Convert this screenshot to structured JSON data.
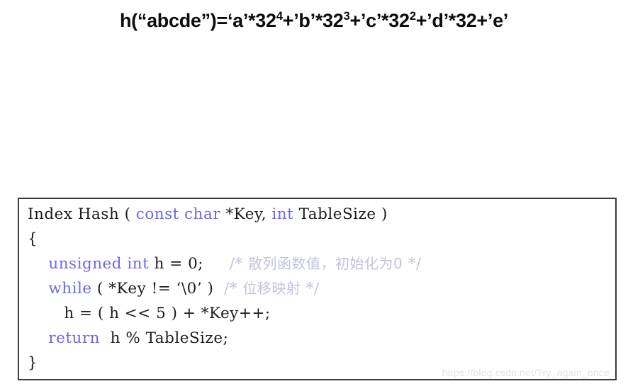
{
  "formula": {
    "parts": [
      {
        "text": "h(“abcde”)=‘a’*32",
        "sup": "4"
      },
      {
        "text": "+’b’*32",
        "sup": "3"
      },
      {
        "text": "+’c’*32",
        "sup": "2"
      },
      {
        "text": "+’d’*32+’e’",
        "sup": ""
      }
    ],
    "plain": "h(“abcde”)=‘a’*32^4+’b’*32^3+’c’*32^2+’d’*32+’e’"
  },
  "code": {
    "language": "C",
    "lines": [
      {
        "id": "signature",
        "tokens": [
          {
            "t": "Index Hash ( ",
            "c": "plain"
          },
          {
            "t": "const char",
            "c": "kw"
          },
          {
            "t": " *Key, ",
            "c": "plain"
          },
          {
            "t": "int",
            "c": "kw"
          },
          {
            "t": " TableSize )",
            "c": "plain"
          }
        ]
      },
      {
        "id": "open-brace",
        "tokens": [
          {
            "t": "{",
            "c": "plain"
          }
        ]
      },
      {
        "id": "declare-h",
        "tokens": [
          {
            "t": "    ",
            "c": "plain"
          },
          {
            "t": "unsigned int",
            "c": "kw"
          },
          {
            "t": " h = 0;     ",
            "c": "plain"
          },
          {
            "t": "/* ",
            "c": "cmt"
          },
          {
            "t": "散列函数值，初始化为0",
            "c": "cmt-cn"
          },
          {
            "t": " */",
            "c": "cmt"
          }
        ]
      },
      {
        "id": "while-loop",
        "tokens": [
          {
            "t": "    ",
            "c": "plain"
          },
          {
            "t": "while",
            "c": "kw"
          },
          {
            "t": " ( *Key != ‘\\0’ )  ",
            "c": "plain"
          },
          {
            "t": "/* ",
            "c": "cmt"
          },
          {
            "t": "位移映射",
            "c": "cmt-cn"
          },
          {
            "t": " */",
            "c": "cmt"
          }
        ]
      },
      {
        "id": "shift-add",
        "tokens": [
          {
            "t": "       h = ( h << 5 ) + *Key++;",
            "c": "plain"
          }
        ]
      },
      {
        "id": "return-stmt",
        "tokens": [
          {
            "t": "    ",
            "c": "plain"
          },
          {
            "t": "return",
            "c": "kw"
          },
          {
            "t": "  h % TableSize;",
            "c": "plain"
          }
        ]
      },
      {
        "id": "close-brace",
        "tokens": [
          {
            "t": "}",
            "c": "plain"
          }
        ]
      }
    ]
  },
  "watermark": {
    "text": "https://blog.csdn.net/Try_again_once"
  },
  "colors": {
    "keyword": "#6a6ae6",
    "comment": "#c2c3dd",
    "code_text": "#1c1c1c",
    "border": "#3b3b3b",
    "background": "#ffffff",
    "watermark": "#e2e2e6"
  }
}
